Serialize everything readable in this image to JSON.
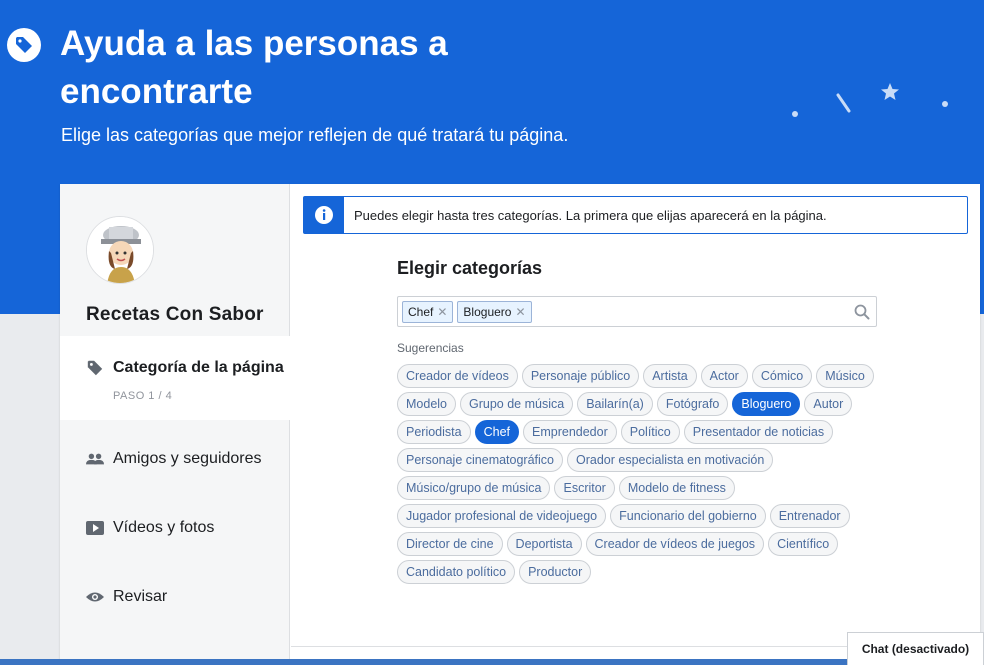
{
  "hero": {
    "title": "Ayuda a las personas a encontrarte",
    "subtitle": "Elige las categorías que mejor reflejen de qué tratará tu página."
  },
  "sidebar": {
    "page_name": "Recetas Con Sabor",
    "steps": [
      {
        "label": "Categoría de la página",
        "sub": "PASO 1 / 4",
        "icon": "tag-icon"
      },
      {
        "label": "Amigos y seguidores",
        "icon": "people-icon"
      },
      {
        "label": "Vídeos y fotos",
        "icon": "video-icon"
      },
      {
        "label": "Revisar",
        "icon": "eye-icon"
      }
    ]
  },
  "info": {
    "text": "Puedes elegir hasta tres categorías. La primera que elijas aparecerá en la página."
  },
  "chooser": {
    "title": "Elegir categorías",
    "tokens": [
      "Chef",
      "Bloguero"
    ],
    "suggestions_label": "Sugerencias",
    "suggestions": [
      "Creador de vídeos",
      "Personaje público",
      "Artista",
      "Actor",
      "Cómico",
      "Músico",
      "Modelo",
      "Grupo de música",
      "Bailarín(a)",
      "Fotógrafo",
      "Bloguero",
      "Autor",
      "Periodista",
      "Chef",
      "Emprendedor",
      "Político",
      "Presentador de noticias",
      "Personaje cinematográfico",
      "Orador especialista en motivación",
      "Músico/grupo de música",
      "Escritor",
      "Modelo de fitness",
      "Jugador profesional de videojuego",
      "Funcionario del gobierno",
      "Entrenador",
      "Director de cine",
      "Deportista",
      "Creador de vídeos de juegos",
      "Científico",
      "Candidato político",
      "Productor"
    ],
    "selected": [
      "Bloguero",
      "Chef"
    ]
  },
  "chat": {
    "label": "Chat (desactivado)"
  },
  "colors": {
    "brand": "#1565d8"
  }
}
